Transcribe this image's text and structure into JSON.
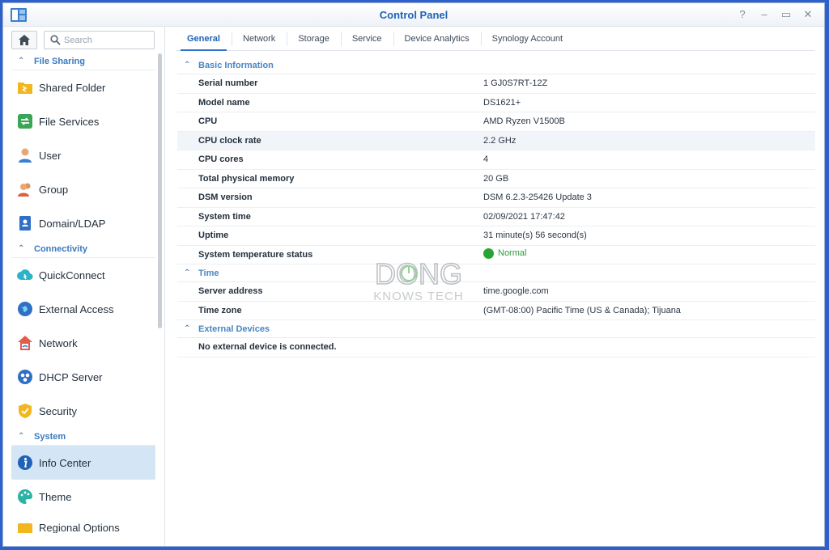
{
  "window": {
    "title": "Control Panel"
  },
  "window_buttons": [
    "?",
    "–",
    "▭",
    "✕"
  ],
  "search": {
    "placeholder": "Search"
  },
  "sidebar": {
    "sections": [
      {
        "label": "File Sharing",
        "items": [
          {
            "label": "Shared Folder",
            "icon": "shared-folder-icon"
          },
          {
            "label": "File Services",
            "icon": "file-services-icon"
          },
          {
            "label": "User",
            "icon": "user-icon"
          },
          {
            "label": "Group",
            "icon": "group-icon"
          },
          {
            "label": "Domain/LDAP",
            "icon": "domain-ldap-icon"
          }
        ]
      },
      {
        "label": "Connectivity",
        "items": [
          {
            "label": "QuickConnect",
            "icon": "quickconnect-icon"
          },
          {
            "label": "External Access",
            "icon": "external-access-icon"
          },
          {
            "label": "Network",
            "icon": "network-icon"
          },
          {
            "label": "DHCP Server",
            "icon": "dhcp-server-icon"
          },
          {
            "label": "Security",
            "icon": "security-icon"
          }
        ]
      },
      {
        "label": "System",
        "items": [
          {
            "label": "Info Center",
            "icon": "info-center-icon",
            "active": true
          },
          {
            "label": "Theme",
            "icon": "theme-icon"
          },
          {
            "label": "Regional Options",
            "icon": "regional-options-icon"
          }
        ]
      }
    ]
  },
  "tabs": [
    {
      "label": "General",
      "active": true
    },
    {
      "label": "Network"
    },
    {
      "label": "Storage"
    },
    {
      "label": "Service"
    },
    {
      "label": "Device Analytics"
    },
    {
      "label": "Synology Account"
    }
  ],
  "basic_info": {
    "header": "Basic Information",
    "rows": [
      {
        "key": "Serial number",
        "value": "1 GJ0S7RT-12Z"
      },
      {
        "key": "Model name",
        "value": "DS1621+"
      },
      {
        "key": "CPU",
        "value": "AMD Ryzen V1500B"
      },
      {
        "key": "CPU clock rate",
        "value": "2.2 GHz"
      },
      {
        "key": "CPU cores",
        "value": "4"
      },
      {
        "key": "Total physical memory",
        "value": "20 GB"
      },
      {
        "key": "DSM version",
        "value": "DSM 6.2.3-25426 Update 3"
      },
      {
        "key": "System time",
        "value": "02/09/2021 17:47:42"
      },
      {
        "key": "Uptime",
        "value": "31 minute(s) 56 second(s)"
      },
      {
        "key": "System temperature status",
        "value": "Normal"
      }
    ]
  },
  "time": {
    "header": "Time",
    "rows": [
      {
        "key": "Server address",
        "value": "time.google.com"
      },
      {
        "key": "Time zone",
        "value": "(GMT-08:00) Pacific Time (US & Canada); Tijuana"
      }
    ]
  },
  "external_devices": {
    "header": "External Devices",
    "message": "No external device is connected."
  },
  "watermark": {
    "line1": "DONG",
    "line2": "KNOWS TECH"
  },
  "colors": {
    "accent": "#1f63b8",
    "status_ok": "#27a532",
    "active_bg": "#d4e6f6"
  }
}
